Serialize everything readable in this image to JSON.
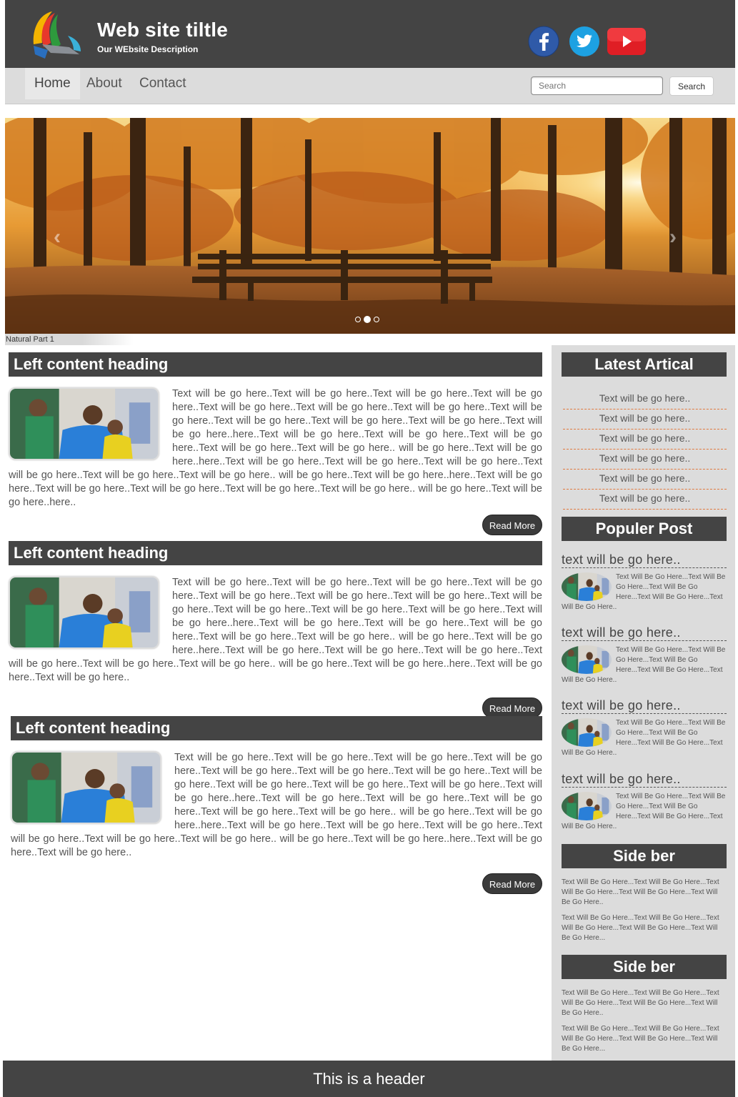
{
  "header": {
    "title": "Web site tiltle",
    "description": "Our WEbsite Description",
    "social": [
      "facebook-icon",
      "twitter-icon",
      "youtube-icon"
    ]
  },
  "nav": {
    "items": [
      "Home",
      "About",
      "Contact"
    ],
    "active": "Home",
    "search_placeholder": "Search",
    "search_button": "Search"
  },
  "slider": {
    "caption": "Natural Part 1",
    "prev": "‹",
    "next": "›",
    "active_dot": 2,
    "dot_count": 3
  },
  "articles": [
    {
      "heading": "Left content heading",
      "text": "Text will be go here..Text will be go here..Text will be go here..Text will be go here..Text will be go here..Text will be go here..Text will be go here..Text will be go here..Text will be go here..Text will be go here..Text will be go here..Text will be go here..here..Text will be go here..Text will be go here..Text will be go here..Text will be go here..Text will be go here.. will be go here..Text will be go here..here..Text will be go here..Text will be go here..Text will be go here..Text will be go here..Text will be go here..Text will be go here.. will be go here..Text will be go here..here..Text will be go here..Text will be go here..Text will be go here..Text will be go here..Text will be go here.. will be go here..Text will be go here..here..",
      "button": "Read More"
    },
    {
      "heading": "Left content heading",
      "text": "Text will be go here..Text will be go here..Text will be go here..Text will be go here..Text will be go here..Text will be go here..Text will be go here..Text will be go here..Text will be go here..Text will be go here..Text will be go here..Text will be go here..here..Text will be go here..Text will be go here..Text will be go here..Text will be go here..Text will be go here.. will be go here..Text will be go here..here..Text will be go here..Text will be go here..Text will be go here..Text will be go here..Text will be go here..Text will be go here.. will be go here..Text will be go here..here..Text will be go here..Text will be go here..",
      "button": "Read More"
    },
    {
      "heading": "Left content heading",
      "text": "Text will be go here..Text will be go here..Text will be go here..Text will be go here..Text will be go here..Text will be go here..Text will be go here..Text will be go here..Text will be go here..Text will be go here..Text will be go here..Text will be go here..here..Text will be go here..Text will be go here..Text will be go here..Text will be go here..Text will be go here.. will be go here..Text will be go here..here..Text will be go here..Text will be go here..Text will be go here..Text will be go here..Text will be go here..Text will be go here.. will be go here..Text will be go here..here..Text will be go here..Text will be go here..",
      "button": "Read More"
    }
  ],
  "sidebar": {
    "latest_heading": "Latest Artical",
    "latest_items": [
      "Text will be go here..",
      "Text will be go here..",
      "Text will be go here..",
      "Text will be go here..",
      "Text will be go here..",
      "Text will be go here.."
    ],
    "popular_heading": "Populer Post",
    "popular_posts": [
      {
        "title": "text will be go here..",
        "text": "Text Will Be Go Here...Text Will Be Go Here...Text Will Be Go Here...Text Will Be Go Here...Text Will Be Go Here.."
      },
      {
        "title": "text will be go here..",
        "text": "Text Will Be Go Here...Text Will Be Go Here...Text Will Be Go Here...Text Will Be Go Here...Text Will Be Go Here.."
      },
      {
        "title": "text will be go here..",
        "text": "Text Will Be Go Here...Text Will Be Go Here...Text Will Be Go Here...Text Will Be Go Here...Text Will Be Go Here.."
      },
      {
        "title": "text will be go here..",
        "text": "Text Will Be Go Here...Text Will Be Go Here...Text Will Be Go Here...Text Will Be Go Here...Text Will Be Go Here.."
      }
    ],
    "side1_heading": "Side ber",
    "side1_p1": "Text Will Be Go Here...Text Will Be Go Here...Text Will Be Go Here...Text Will Be Go Here...Text Will Be Go Here..",
    "side1_p2": "Text Will Be Go Here...Text Will Be Go Here...Text Will Be Go Here...Text Will Be Go Here...Text Will Be Go Here...",
    "side2_heading": "Side ber",
    "side2_p1": "Text Will Be Go Here...Text Will Be Go Here...Text Will Be Go Here...Text Will Be Go Here...Text Will Be Go Here..",
    "side2_p2": "Text Will Be Go Here...Text Will Be Go Here...Text Will Be Go Here...Text Will Be Go Here...Text Will Be Go Here..."
  },
  "footer": {
    "text": "This is a header"
  },
  "colors": {
    "dark": "#444444",
    "nav_bg": "#dcdcdc",
    "sidebar_bg": "#dcdcdc",
    "accent_dashed": "#e07a40"
  }
}
